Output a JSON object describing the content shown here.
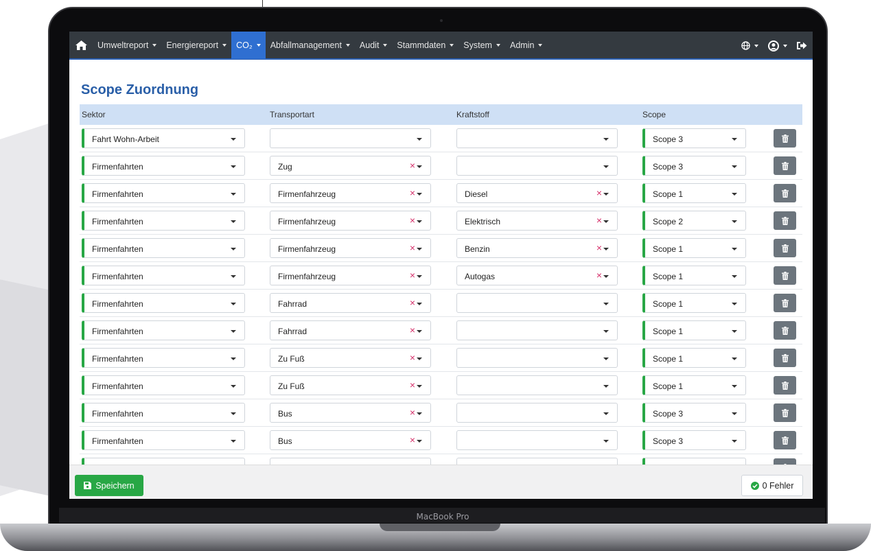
{
  "device": {
    "label": "MacBook Pro"
  },
  "navbar": {
    "home_icon": "home-icon",
    "items": [
      {
        "label": "Umweltreport",
        "active": false
      },
      {
        "label": "Energiereport",
        "active": false
      },
      {
        "label": "CO₂",
        "active": true
      },
      {
        "label": "Abfallmanagement",
        "active": false
      },
      {
        "label": "Audit",
        "active": false
      },
      {
        "label": "Stammdaten",
        "active": false
      },
      {
        "label": "System",
        "active": false
      },
      {
        "label": "Admin",
        "active": false
      }
    ],
    "right_icons": [
      "globe-icon",
      "user-circle-icon",
      "sign-out-icon"
    ]
  },
  "page": {
    "title": "Scope Zuordnung"
  },
  "table": {
    "headers": {
      "sektor": "Sektor",
      "transportart": "Transportart",
      "kraftstoff": "Kraftstoff",
      "scope": "Scope"
    },
    "rows": [
      {
        "sektor": "Fahrt Wohn-Arbeit",
        "transportart": "",
        "kraftstoff": "",
        "scope": "Scope 3"
      },
      {
        "sektor": "Firmenfahrten",
        "transportart": "Zug",
        "kraftstoff": "",
        "scope": "Scope 3"
      },
      {
        "sektor": "Firmenfahrten",
        "transportart": "Firmenfahrzeug",
        "kraftstoff": "Diesel",
        "scope": "Scope 1"
      },
      {
        "sektor": "Firmenfahrten",
        "transportart": "Firmenfahrzeug",
        "kraftstoff": "Elektrisch",
        "scope": "Scope 2"
      },
      {
        "sektor": "Firmenfahrten",
        "transportart": "Firmenfahrzeug",
        "kraftstoff": "Benzin",
        "scope": "Scope 1"
      },
      {
        "sektor": "Firmenfahrten",
        "transportart": "Firmenfahrzeug",
        "kraftstoff": "Autogas",
        "scope": "Scope 1"
      },
      {
        "sektor": "Firmenfahrten",
        "transportart": "Fahrrad",
        "kraftstoff": "",
        "scope": "Scope 1"
      },
      {
        "sektor": "Firmenfahrten",
        "transportart": "Fahrrad",
        "kraftstoff": "",
        "scope": "Scope 1"
      },
      {
        "sektor": "Firmenfahrten",
        "transportart": "Zu Fuß",
        "kraftstoff": "",
        "scope": "Scope 1"
      },
      {
        "sektor": "Firmenfahrten",
        "transportart": "Zu Fuß",
        "kraftstoff": "",
        "scope": "Scope 1"
      },
      {
        "sektor": "Firmenfahrten",
        "transportart": "Bus",
        "kraftstoff": "",
        "scope": "Scope 3"
      },
      {
        "sektor": "Firmenfahrten",
        "transportart": "Bus",
        "kraftstoff": "",
        "scope": "Scope 3"
      },
      {
        "sektor": "",
        "transportart": "",
        "kraftstoff": "",
        "scope": ""
      }
    ],
    "clear_glyph": "×"
  },
  "footer": {
    "save_label": "Speichern",
    "errors_label": "0 Fehler"
  },
  "colors": {
    "navbar": "#343a40",
    "active_nav": "#2f6fd1",
    "title": "#2a5fa8",
    "header_row": "#cfe0f5",
    "valid": "#28a745",
    "clear": "#d6336c",
    "delete": "#6c757d"
  }
}
